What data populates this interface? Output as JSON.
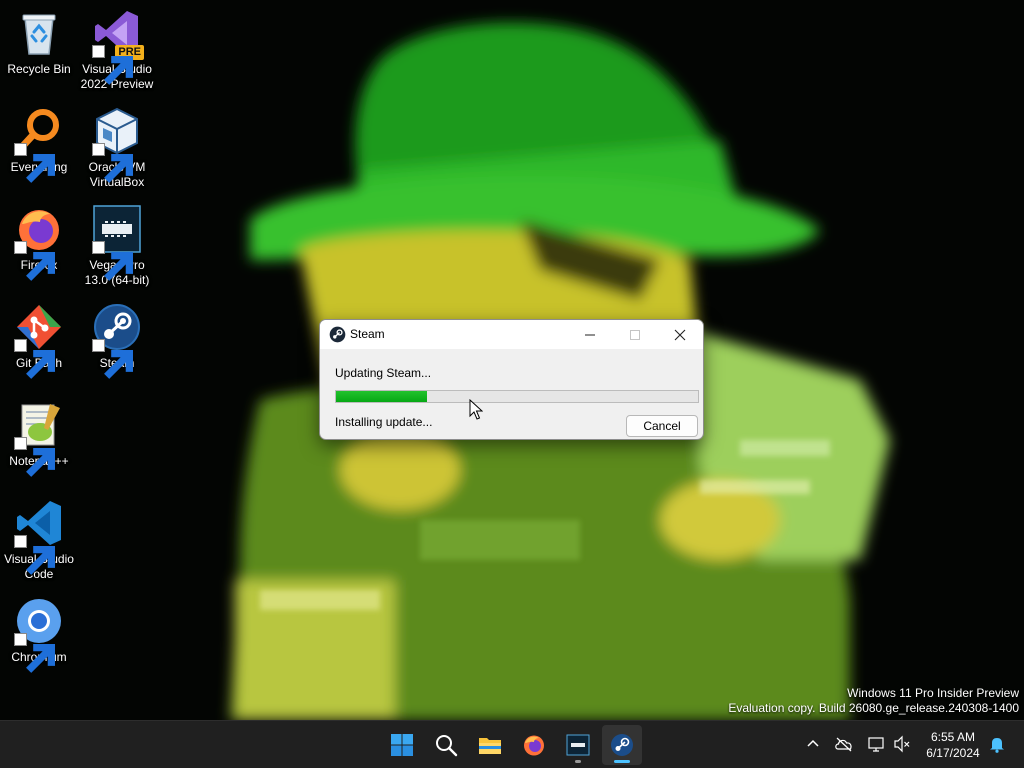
{
  "desktop": {
    "icons": [
      {
        "label": "Recycle Bin",
        "icon": "recycle-bin-icon"
      },
      {
        "label": "Visual Studio 2022 Preview",
        "icon": "visual-studio-icon",
        "badge": "PRE"
      },
      {
        "label": "Everything",
        "icon": "everything-search-icon"
      },
      {
        "label": "Oracle VM VirtualBox",
        "icon": "virtualbox-icon"
      },
      {
        "label": "Firefox",
        "icon": "firefox-icon"
      },
      {
        "label": "Vegas Pro 13.0 (64-bit)",
        "icon": "vegas-pro-icon"
      },
      {
        "label": "Git Bash",
        "icon": "git-bash-icon"
      },
      {
        "label": "Steam",
        "icon": "steam-icon"
      },
      {
        "label": "Notepad++",
        "icon": "notepad-plus-plus-icon"
      },
      {
        "label": "Visual Studio Code",
        "icon": "vscode-icon"
      },
      {
        "label": "Chromium",
        "icon": "chromium-icon"
      }
    ],
    "watermark": {
      "line1": "Windows 11 Pro Insider Preview",
      "line2": "Evaluation copy. Build 26080.ge_release.240308-1400"
    }
  },
  "steam_dialog": {
    "title": "Steam",
    "status": "Updating Steam...",
    "progress_percent": 25,
    "substatus": "Installing update...",
    "cancel_label": "Cancel"
  },
  "taskbar": {
    "apps": [
      "start-icon",
      "search-icon",
      "file-explorer-icon",
      "firefox-icon",
      "vegas-pro-icon",
      "steam-icon"
    ],
    "tray": [
      "chevron-up-icon",
      "onedrive-icon",
      "network-icon",
      "volume-muted-icon"
    ],
    "clock": {
      "time": "6:55 AM",
      "date": "6/17/2024"
    }
  },
  "colors": {
    "progress_fill": "#06b025",
    "taskbar_bg": "#202020",
    "accent": "#4cc2ff"
  }
}
